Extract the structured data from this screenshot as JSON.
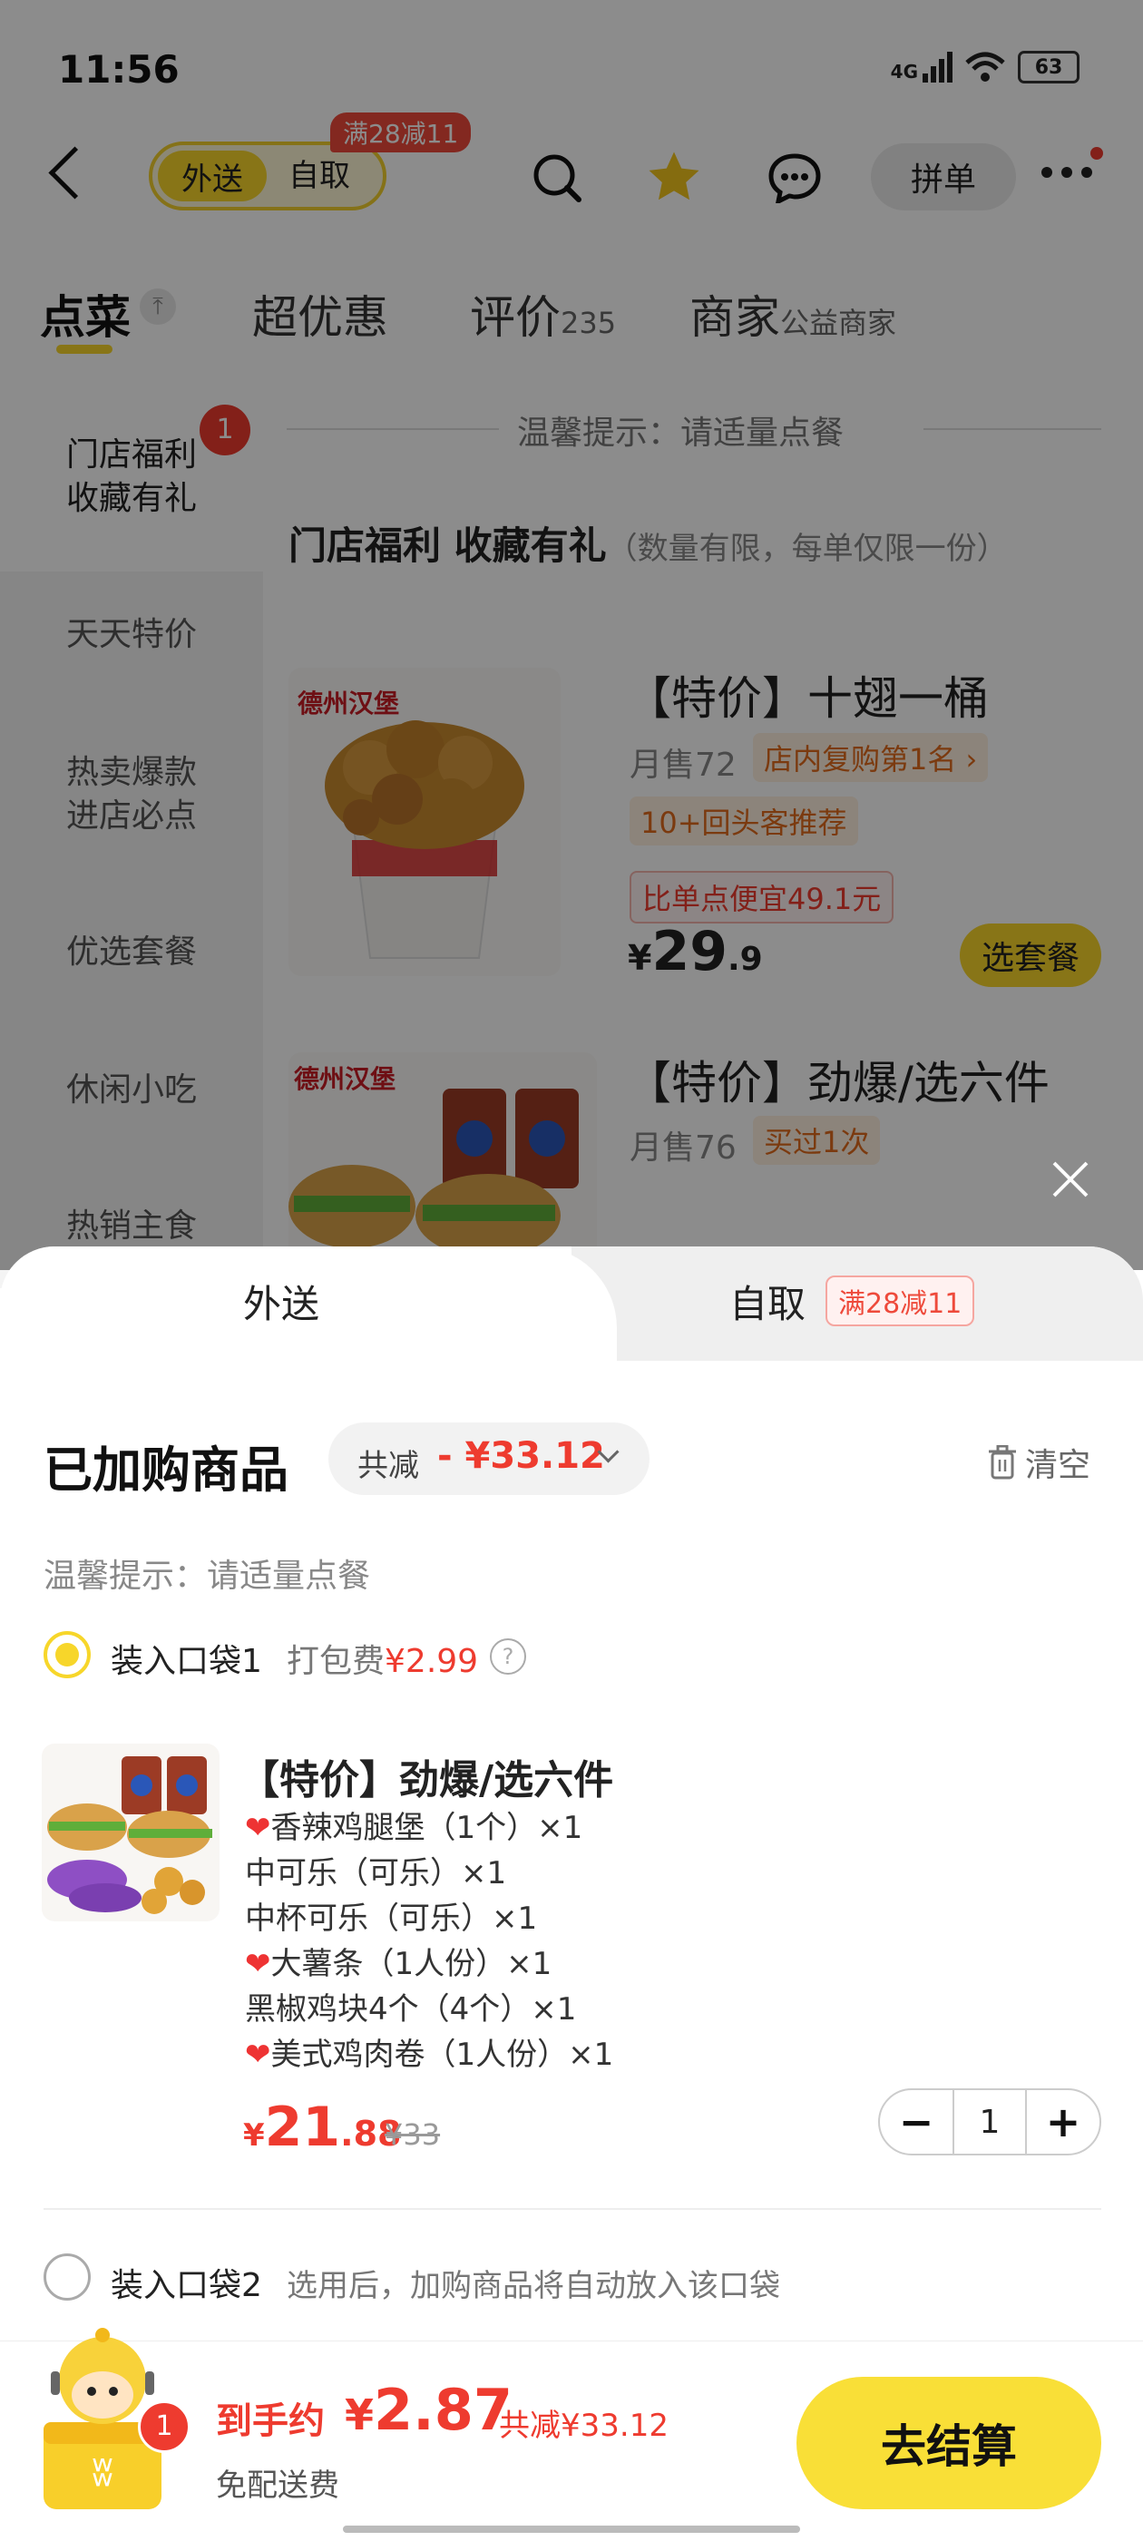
{
  "status_bar": {
    "time": "11:56",
    "network": "4G",
    "battery": "63"
  },
  "header": {
    "mode_delivery": "外送",
    "mode_pickup": "自取",
    "promo": "满28减11",
    "pindan": "拼单"
  },
  "tabs": [
    {
      "label": "点菜",
      "suffix": ""
    },
    {
      "label": "超优惠",
      "suffix": ""
    },
    {
      "label": "评价",
      "suffix": "235"
    },
    {
      "label": "商家",
      "suffix": "公益商家"
    }
  ],
  "sidebar": {
    "badge": "1",
    "items": [
      {
        "line1": "门店福利",
        "line2": "收藏有礼"
      },
      {
        "line1": "天天特价",
        "line2": ""
      },
      {
        "line1": "热卖爆款",
        "line2": "进店必点"
      },
      {
        "line1": "优选套餐",
        "line2": ""
      },
      {
        "line1": "休闲小吃",
        "line2": ""
      },
      {
        "line1": "热销主食",
        "line2": ""
      }
    ]
  },
  "menu": {
    "tip": "温馨提示：请适量点餐",
    "section_title": "门店福利  收藏有礼",
    "section_note": "（数量有限，每单仅限一份）",
    "products": [
      {
        "brand": "德州汉堡",
        "name": "【特价】十翅一桶",
        "sold": "月售72",
        "rank": "店内复购第1名",
        "tag": "10+回头客推荐",
        "saving": "比单点便宜49.1元",
        "price_int": "29",
        "price_dec": ".9",
        "button": "选套餐"
      },
      {
        "brand": "德州汉堡",
        "name": "【特价】劲爆/选六件",
        "sold": "月售76",
        "rank": "买过1次"
      }
    ]
  },
  "sheet": {
    "tab_delivery": "外送",
    "tab_pickup": "自取",
    "tab_promo": "满28减11",
    "title": "已加购商品",
    "discount_label": "共减",
    "discount_value": "- ¥33.12",
    "clear": "清空",
    "warm_tip": "温馨提示：请适量点餐",
    "bag1_label": "装入口袋1",
    "bag1_fee_label": "打包费",
    "bag1_fee": "¥2.99",
    "item": {
      "name": "【特价】劲爆/选六件",
      "options": [
        {
          "heart": true,
          "text": "香辣鸡腿堡（1个）×1"
        },
        {
          "heart": false,
          "text": "中可乐（可乐）×1"
        },
        {
          "heart": false,
          "text": "中杯可乐（可乐）×1"
        },
        {
          "heart": true,
          "text": "大薯条（1人份）×1"
        },
        {
          "heart": false,
          "text": "黑椒鸡块4个（4个）×1"
        },
        {
          "heart": true,
          "text": "美式鸡肉卷（1人份）×1"
        }
      ],
      "price_int": "21",
      "price_dec": ".88",
      "orig_price": "¥33",
      "quantity": "1"
    },
    "bag2_label": "装入口袋2",
    "bag2_hint": "选用后，加购商品将自动放入该口袋"
  },
  "checkout": {
    "cart_count": "1",
    "total_label": "到手约",
    "total_value": "2.87",
    "total_discount": "共减¥33.12",
    "free_delivery": "免配送费",
    "button": "去结算"
  },
  "colors": {
    "accent": "#f7d62a",
    "price_red": "#ee3b2f",
    "promo_red": "#ee4a3b"
  }
}
